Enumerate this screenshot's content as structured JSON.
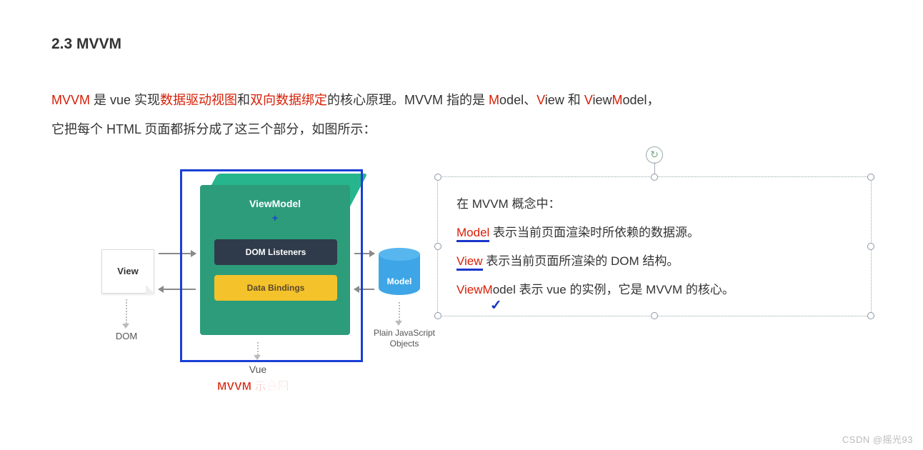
{
  "heading": "2.3 MVVM",
  "para": {
    "p1a": "MVVM",
    "p1b": " 是 vue 实现",
    "p1c": "数据驱动视图",
    "p1d": "和",
    "p1e": "双向数据绑定",
    "p1f": "的核心原理。MVVM 指的是 ",
    "m": "M",
    "odel": "odel、",
    "v": "V",
    "iew": "iew 和 ",
    "vm_v1": "V",
    "vm_mid": "iew",
    "vm_m2": "M",
    "vm_tail": "odel，",
    "p2": "它把每个 HTML 页面都拆分成了这三个部分，如图所示："
  },
  "diagram": {
    "viewmodel": "ViewModel",
    "dom_listeners": "DOM Listeners",
    "data_bindings": "Data Bindings",
    "view": "View",
    "model": "Model",
    "cap_dom": "DOM",
    "cap_vue": "Vue",
    "cap_pjs_l1": "Plain JavaScript",
    "cap_pjs_l2": "Objects",
    "caption": "MVVM 示意图",
    "plus": "+"
  },
  "box": {
    "l1": "在 MVVM 概念中：",
    "l2a": "Model",
    "l2b": " 表示当前页面渲染时所依赖的数据源。",
    "l3a": "View",
    "l3b": "  表示当前页面所渲染的 DOM 结构。",
    "l4a": "View",
    "l4b": "M",
    "l4c": "odel 表示 vue 的实例，它是 MVVM 的核心。",
    "rotate_glyph": "↻"
  },
  "watermark": "CSDN @摇光93"
}
